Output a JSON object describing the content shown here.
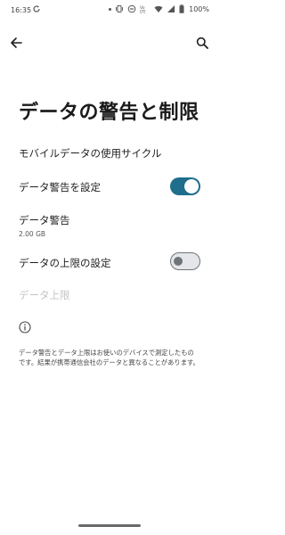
{
  "status_bar": {
    "time": "16:35",
    "battery_percent": "100%",
    "icons": [
      "sync-icon",
      "notification-dot-icon",
      "vibrate-icon",
      "do-not-disturb-icon",
      "volte-icon",
      "wifi-icon",
      "signal-icon",
      "battery-icon"
    ]
  },
  "app_bar": {
    "back_icon": "arrow-back-icon",
    "search_icon": "search-icon"
  },
  "page": {
    "title": "データの警告と制限"
  },
  "settings": {
    "usage_cycle_label": "モバイルデータの使用サイクル",
    "set_warning_label": "データ警告を設定",
    "set_warning_enabled": true,
    "warning_label": "データ警告",
    "warning_value": "2.00 GB",
    "set_limit_label": "データの上限の設定",
    "set_limit_enabled": false,
    "limit_label": "データ上限"
  },
  "footer": {
    "info_icon": "info-icon",
    "note": "データ警告とデータ上限はお使いのデバイスで測定したものです。結果が携帯通信会社のデータと異なることがあります。"
  },
  "colors": {
    "accent": "#1f6e8c",
    "disabled_text": "#c4c4c4"
  }
}
